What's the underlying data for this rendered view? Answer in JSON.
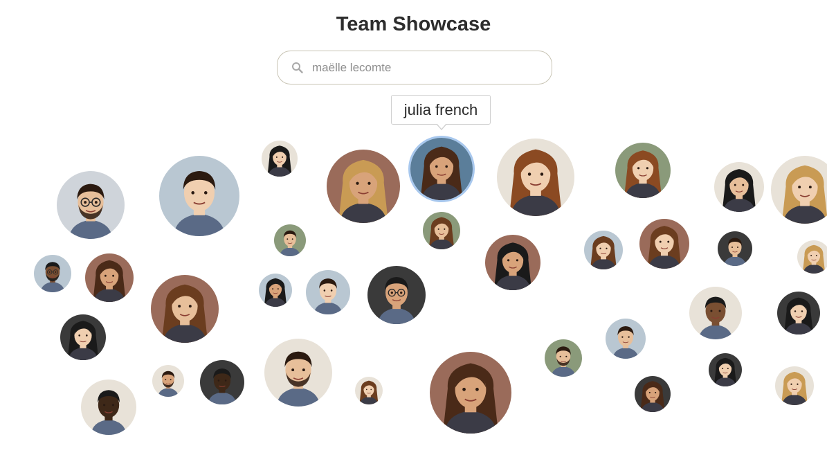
{
  "header": {
    "title": "Team Showcase"
  },
  "search": {
    "value": "",
    "placeholder": "maëlle lecomte",
    "icon": "search-icon"
  },
  "tooltip": {
    "name": "julia french"
  },
  "palette": {
    "skin": [
      "#e7bf9a",
      "#d8a37a",
      "#f0cfb0",
      "#c48a5c",
      "#7a4f32",
      "#3e2818"
    ],
    "hair": [
      "#2b1a10",
      "#6b3d1f",
      "#c99b54",
      "#1a1a1a",
      "#8b4a22",
      "#4a2a18"
    ],
    "bg": [
      "#cfd4da",
      "#8a9a7a",
      "#d9c7a8",
      "#5b7e9a",
      "#e8e2d8",
      "#3a3a3a",
      "#b9c7d2",
      "#9a6b5a"
    ]
  },
  "members": [
    {
      "id": 1,
      "skin": 0,
      "hair": 0,
      "bg": 0,
      "long": false,
      "beard": true,
      "glasses": true
    },
    {
      "id": 2,
      "skin": 2,
      "hair": 0,
      "bg": 6,
      "long": false,
      "beard": false,
      "glasses": false
    },
    {
      "id": 3,
      "skin": 2,
      "hair": 3,
      "bg": 4,
      "long": true,
      "beard": false,
      "glasses": false
    },
    {
      "id": 4,
      "skin": 1,
      "hair": 2,
      "bg": 7,
      "long": true,
      "beard": false,
      "glasses": false
    },
    {
      "id": 5,
      "skin": 1,
      "hair": 5,
      "bg": 3,
      "long": true,
      "beard": false,
      "glasses": false,
      "active": true
    },
    {
      "id": 6,
      "skin": 2,
      "hair": 4,
      "bg": 4,
      "long": true,
      "beard": false,
      "glasses": false
    },
    {
      "id": 7,
      "skin": 2,
      "hair": 4,
      "bg": 1,
      "long": true,
      "beard": false,
      "glasses": false
    },
    {
      "id": 8,
      "skin": 0,
      "hair": 3,
      "bg": 4,
      "long": true,
      "beard": false,
      "glasses": false
    },
    {
      "id": 9,
      "skin": 2,
      "hair": 2,
      "bg": 4,
      "long": true,
      "beard": false,
      "glasses": false
    },
    {
      "id": 10,
      "skin": 0,
      "hair": 0,
      "bg": 1,
      "long": false,
      "beard": false,
      "glasses": false
    },
    {
      "id": 11,
      "skin": 0,
      "hair": 1,
      "bg": 1,
      "long": true,
      "beard": false,
      "glasses": false
    },
    {
      "id": 12,
      "skin": 1,
      "hair": 3,
      "bg": 7,
      "long": true,
      "beard": false,
      "glasses": false
    },
    {
      "id": 13,
      "skin": 2,
      "hair": 1,
      "bg": 6,
      "long": true,
      "beard": false,
      "glasses": false
    },
    {
      "id": 14,
      "skin": 2,
      "hair": 1,
      "bg": 7,
      "long": true,
      "beard": false,
      "glasses": false
    },
    {
      "id": 15,
      "skin": 0,
      "hair": 0,
      "bg": 5,
      "long": false,
      "beard": false,
      "glasses": false
    },
    {
      "id": 16,
      "skin": 2,
      "hair": 2,
      "bg": 4,
      "long": true,
      "beard": false,
      "glasses": false
    },
    {
      "id": 17,
      "skin": 4,
      "hair": 3,
      "bg": 6,
      "long": false,
      "beard": true,
      "glasses": true
    },
    {
      "id": 18,
      "skin": 1,
      "hair": 5,
      "bg": 7,
      "long": true,
      "beard": false,
      "glasses": false
    },
    {
      "id": 19,
      "skin": 0,
      "hair": 1,
      "bg": 7,
      "long": true,
      "beard": false,
      "glasses": false
    },
    {
      "id": 20,
      "skin": 1,
      "hair": 3,
      "bg": 6,
      "long": true,
      "beard": false,
      "glasses": false
    },
    {
      "id": 21,
      "skin": 2,
      "hair": 0,
      "bg": 6,
      "long": false,
      "beard": false,
      "glasses": false
    },
    {
      "id": 22,
      "skin": 1,
      "hair": 3,
      "bg": 5,
      "long": false,
      "beard": false,
      "glasses": true
    },
    {
      "id": 23,
      "skin": 4,
      "hair": 3,
      "bg": 4,
      "long": false,
      "beard": false,
      "glasses": false
    },
    {
      "id": 24,
      "skin": 2,
      "hair": 3,
      "bg": 5,
      "long": true,
      "beard": false,
      "glasses": false
    },
    {
      "id": 25,
      "skin": 2,
      "hair": 3,
      "bg": 5,
      "long": true,
      "beard": false,
      "glasses": false
    },
    {
      "id": 26,
      "skin": 0,
      "hair": 0,
      "bg": 6,
      "long": false,
      "beard": false,
      "glasses": false
    },
    {
      "id": 27,
      "skin": 1,
      "hair": 0,
      "bg": 4,
      "long": false,
      "beard": true,
      "glasses": false
    },
    {
      "id": 28,
      "skin": 5,
      "hair": 3,
      "bg": 5,
      "long": false,
      "beard": false,
      "glasses": false
    },
    {
      "id": 29,
      "skin": 0,
      "hair": 0,
      "bg": 4,
      "long": false,
      "beard": true,
      "glasses": false
    },
    {
      "id": 30,
      "skin": 2,
      "hair": 1,
      "bg": 4,
      "long": true,
      "beard": false,
      "glasses": false
    },
    {
      "id": 31,
      "skin": 1,
      "hair": 5,
      "bg": 7,
      "long": true,
      "beard": false,
      "glasses": false
    },
    {
      "id": 32,
      "skin": 0,
      "hair": 0,
      "bg": 1,
      "long": false,
      "beard": true,
      "glasses": false
    },
    {
      "id": 33,
      "skin": 2,
      "hair": 3,
      "bg": 5,
      "long": true,
      "beard": false,
      "glasses": false
    },
    {
      "id": 34,
      "skin": 5,
      "hair": 3,
      "bg": 4,
      "long": false,
      "beard": false,
      "glasses": false
    },
    {
      "id": 35,
      "skin": 1,
      "hair": 5,
      "bg": 5,
      "long": true,
      "beard": false,
      "glasses": false
    },
    {
      "id": 36,
      "skin": 2,
      "hair": 2,
      "bg": 4,
      "long": true,
      "beard": false,
      "glasses": false
    },
    {
      "id": 37,
      "skin": 2,
      "hair": 0,
      "bg": 6,
      "long": false,
      "beard": false,
      "glasses": false
    },
    {
      "id": 38,
      "skin": 1,
      "hair": 3,
      "bg": 5,
      "long": true,
      "beard": false,
      "glasses": false
    },
    {
      "id": 39,
      "skin": 1,
      "hair": 4,
      "bg": 4,
      "long": true,
      "beard": false,
      "glasses": false
    }
  ]
}
